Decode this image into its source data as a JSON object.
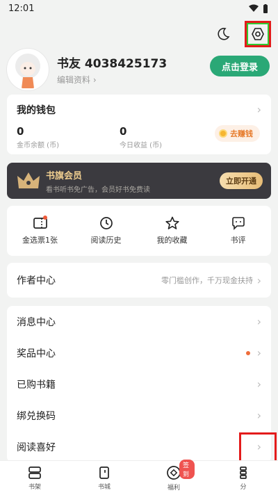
{
  "status": {
    "time": "12:01",
    "wifi_icon": "wifi-icon",
    "battery_icon": "battery-icon"
  },
  "topbar": {
    "night_icon": "moon-icon",
    "settings_icon": "hexagon-settings-icon"
  },
  "profile": {
    "username": "书友 4038425173",
    "edit_label": "编辑资料",
    "login_label": "点击登录"
  },
  "wallet": {
    "title": "我的钱包",
    "coin_value": "0",
    "coin_label": "金币余额 (币)",
    "today_value": "0",
    "today_label": "今日收益 (币)",
    "earn_label": "去赚钱"
  },
  "vip": {
    "title": "书旗会员",
    "subtitle": "看书听书免广告，会员好书免费读",
    "button_label": "立即开通"
  },
  "shortcuts": [
    {
      "label": "金选票1张",
      "icon": "ticket-icon"
    },
    {
      "label": "阅读历史",
      "icon": "clock-icon"
    },
    {
      "label": "我的收藏",
      "icon": "star-icon"
    },
    {
      "label": "书评",
      "icon": "comment-icon"
    }
  ],
  "author": {
    "title": "作者中心",
    "hint": "零门槛创作，千万现金扶持"
  },
  "menu": [
    {
      "label": "消息中心"
    },
    {
      "label": "奖品中心"
    },
    {
      "label": "已购书籍"
    },
    {
      "label": "绑兑换码"
    },
    {
      "label": "阅读喜好"
    }
  ],
  "tabs": [
    {
      "label": "书架",
      "icon": "bookshelf-icon"
    },
    {
      "label": "书城",
      "icon": "bookstore-icon"
    },
    {
      "label": "福利",
      "icon": "welfare-icon",
      "badge": "签到"
    },
    {
      "label": "分",
      "icon": "category-icon"
    }
  ],
  "colors": {
    "accent": "#2aa876",
    "vip_gold": "#f0cf90",
    "highlight_red": "#e31b1b"
  }
}
